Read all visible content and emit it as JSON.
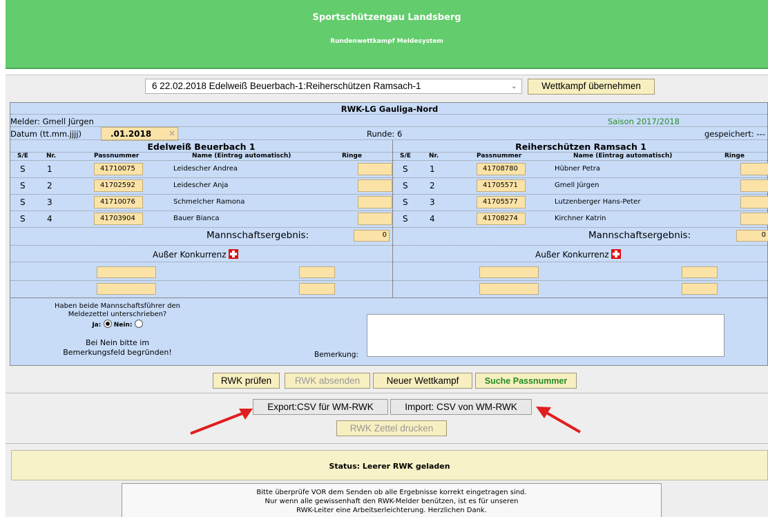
{
  "banner": {
    "title": "Sportschützengau Landsberg",
    "subtitle": "Rundenwettkampf Meldesystem"
  },
  "select": {
    "value": "6 22.02.2018 Edelweiß Beuerbach-1:Reiherschützen Ramsach-1",
    "button": "Wettkampf übernehmen"
  },
  "form": {
    "title": "RWK-LG Gauliga-Nord",
    "melder_label": "Melder: Gmell Jürgen",
    "saison": "Saison 2017/2018",
    "datum_label": "Datum (tt.mm.jjjj)",
    "datum_value": ".01.2018",
    "datum_clear": "×",
    "runde": "Runde: 6",
    "gespeichert": "gespeichert: ---",
    "columns": {
      "se": "S/E",
      "nr": "Nr.",
      "pass": "Passnummer",
      "name": "Name (Eintrag automatisch)",
      "ringe": "Ringe"
    },
    "home": {
      "team": "Edelweiß Beuerbach 1",
      "rows": [
        {
          "se": "S",
          "nr": "1",
          "pass": "41710075",
          "name": "Leidescher Andrea"
        },
        {
          "se": "S",
          "nr": "2",
          "pass": "41702592",
          "name": "Leidescher Anja"
        },
        {
          "se": "S",
          "nr": "3",
          "pass": "41710076",
          "name": "Schmelcher Ramona"
        },
        {
          "se": "S",
          "nr": "4",
          "pass": "41703904",
          "name": "Bauer Bianca"
        }
      ],
      "result_label": "Mannschaftsergebnis:",
      "result_value": "0",
      "ak_label": "Außer Konkurrenz"
    },
    "away": {
      "team": "Reiherschützen Ramsach 1",
      "rows": [
        {
          "se": "S",
          "nr": "1",
          "pass": "41708780",
          "name": "Hübner Petra"
        },
        {
          "se": "S",
          "nr": "2",
          "pass": "41705571",
          "name": "Gmell Jürgen"
        },
        {
          "se": "S",
          "nr": "3",
          "pass": "41705577",
          "name": "Lutzenberger Hans-Peter"
        },
        {
          "se": "S",
          "nr": "4",
          "pass": "41708274",
          "name": "Kirchner Katrin"
        }
      ],
      "result_label": "Mannschaftsergebnis:",
      "result_value": "0",
      "ak_label": "Außer Konkurrenz"
    },
    "signature": {
      "question_line1": "Haben beide Mannschaftsführer den",
      "question_line2": "Meldezettel unterschrieben?",
      "ja": "Ja:",
      "nein": "Nein:",
      "hint_line1": "Bei Nein bitte im",
      "hint_line2": "Bemerkungsfeld begründen!",
      "bemerkung": "Bemerkung:"
    }
  },
  "buttons": {
    "pruefen": "RWK prüfen",
    "absenden": "RWK absenden",
    "neu": "Neuer Wettkampf",
    "suche": "Suche Passnummer",
    "export": "Export:CSV für WM-RWK",
    "import": "Import: CSV von WM-RWK",
    "drucken": "RWK Zettel drucken"
  },
  "status": "Status: Leerer RWK geladen",
  "note": {
    "line1": "Bitte überprüfe VOR dem Senden ob alle Ergebnisse korrekt eingetragen sind.",
    "line2": "Nur wenn alle gewissenhaft den RWK-Melder benützen, ist es für unseren",
    "line3": "RWK-Leiter eine Arbeitserleichterung. Herzlichen Dank."
  },
  "colors": {
    "banner": "#63cc6c",
    "form": "#c8dcf8",
    "input": "#fbe3a8",
    "arrow": "#e01e1e"
  }
}
